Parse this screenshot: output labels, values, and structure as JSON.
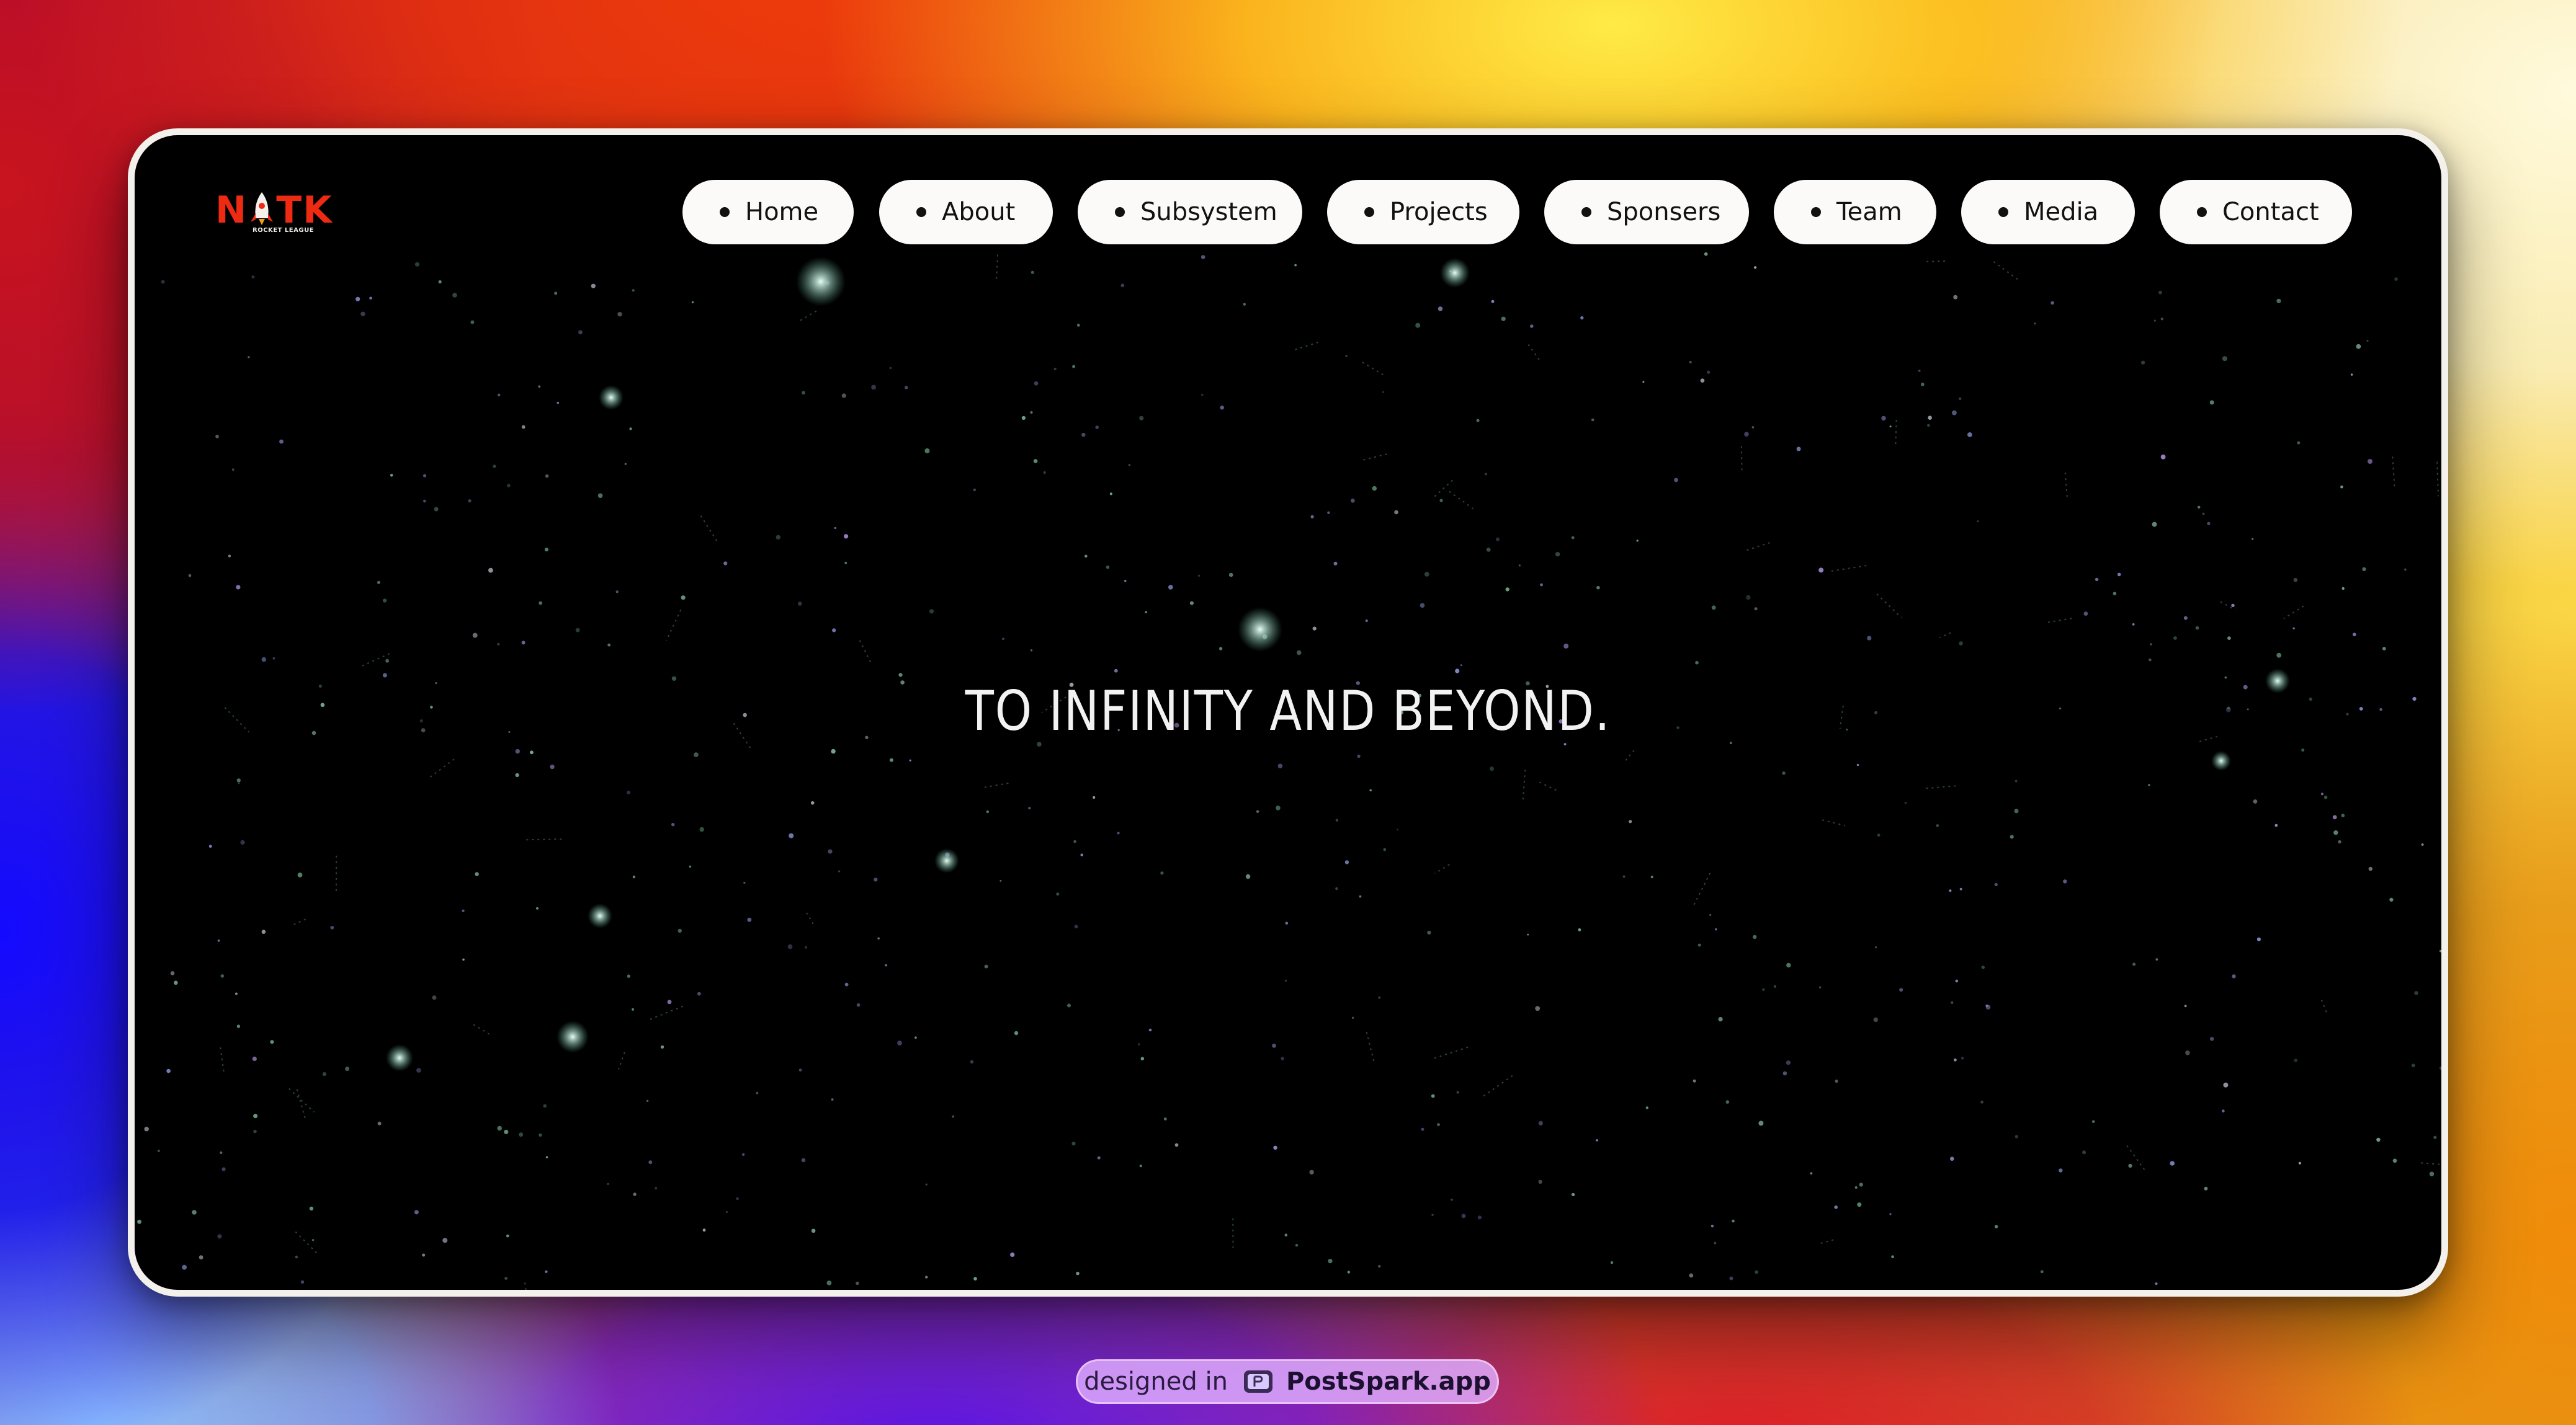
{
  "window": {
    "logo": {
      "letters_before": "N",
      "letters_after": "TK",
      "subtitle": "ROCKET LEAGUE",
      "icon": "rocket-icon",
      "color": "#ee2a12"
    },
    "nav": {
      "items": [
        {
          "label": "Home"
        },
        {
          "label": "About"
        },
        {
          "label": "Subsystem"
        },
        {
          "label": "Projects"
        },
        {
          "label": "Sponsers"
        },
        {
          "label": "Team"
        },
        {
          "label": "Media"
        },
        {
          "label": "Contact"
        }
      ]
    },
    "hero": {
      "title": "TO INFINITY AND BEYOND."
    },
    "background": "starfield"
  },
  "badge": {
    "prefix": "designed in",
    "icon": "postspark-icon",
    "brand": "PostSpark.app"
  }
}
